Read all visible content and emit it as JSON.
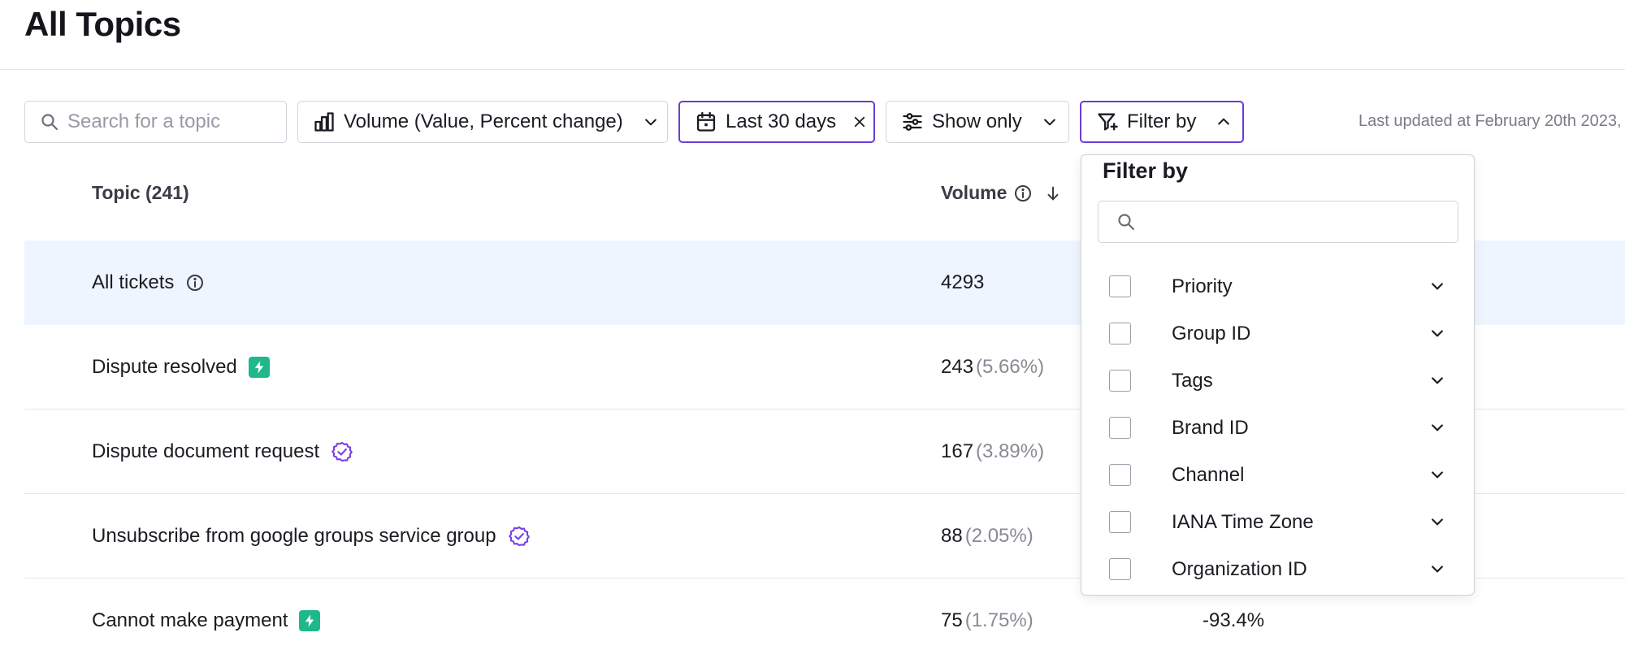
{
  "page_title": "All Topics",
  "toolbar": {
    "search_placeholder": "Search for a topic",
    "search_value": "",
    "metric_label": "Volume (Value, Percent change)",
    "date_label": "Last 30 days",
    "show_only_label": "Show only",
    "filter_label": "Filter by",
    "last_updated": "Last updated at February 20th 2023,"
  },
  "table": {
    "col_topic": "Topic (241)",
    "col_volume": "Volume",
    "rows": [
      {
        "topic": "All tickets",
        "volume": "4293",
        "pct": "",
        "change": "",
        "badge": "info-icon"
      },
      {
        "topic": "Dispute resolved",
        "volume": "243",
        "pct": "(5.66%)",
        "change": "",
        "badge": "bolt-icon"
      },
      {
        "topic": "Dispute document request",
        "volume": "167",
        "pct": "(3.89%)",
        "change": "",
        "badge": "verified-icon"
      },
      {
        "topic": "Unsubscribe from google groups service group",
        "volume": "88",
        "pct": "(2.05%)",
        "change": "",
        "badge": "verified-icon"
      },
      {
        "topic": "Cannot make payment",
        "volume": "75",
        "pct": "(1.75%)",
        "change": "-93.4%",
        "badge": "bolt-icon"
      }
    ]
  },
  "filter_dropdown": {
    "title": "Filter by",
    "search_value": "",
    "items": [
      {
        "label": "Priority",
        "checked": false
      },
      {
        "label": "Group ID",
        "checked": false
      },
      {
        "label": "Tags",
        "checked": false
      },
      {
        "label": "Brand ID",
        "checked": false
      },
      {
        "label": "Channel",
        "checked": false
      },
      {
        "label": "IANA Time Zone",
        "checked": false
      },
      {
        "label": "Organization ID",
        "checked": false
      }
    ]
  },
  "colors": {
    "accent_purple": "#6a3cd6",
    "bolt_green": "#1fb88a",
    "highlight_row": "#eef5fe"
  }
}
